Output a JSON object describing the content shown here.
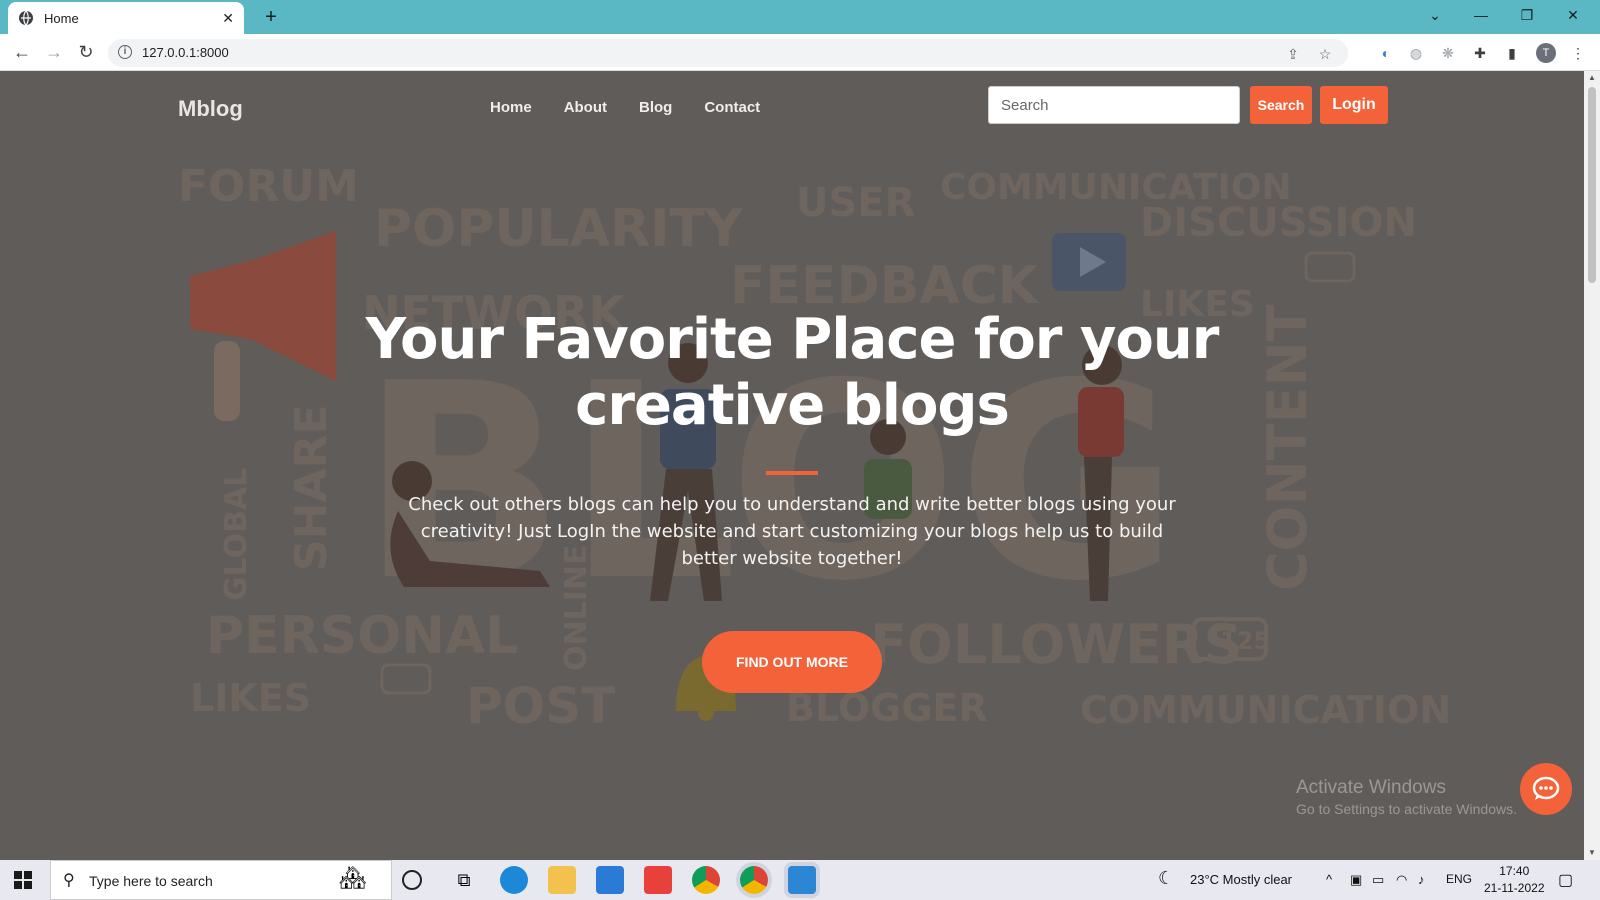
{
  "browser": {
    "tab_title": "Home",
    "url": "127.0.0.1:8000"
  },
  "site": {
    "brand": "Mblog",
    "nav": [
      "Home",
      "About",
      "Blog",
      "Contact"
    ],
    "search_placeholder": "Search",
    "search_button": "Search",
    "login_button": "Login"
  },
  "hero": {
    "title": "Your Favorite Place for your creative blogs",
    "text": "Check out others blogs can help you to understand and write better blogs using your creativity! Just LogIn the website and start customizing your blogs help us to build better website together!",
    "cta": "FIND OUT MORE"
  },
  "background_words": [
    "FORUM",
    "POPULARITY",
    "USER",
    "COMMUNICATION",
    "DISCUSSION",
    "FEEDBACK",
    "LIKES",
    "NETWORK",
    "BLOG",
    "CONTENT",
    "PERSONAL",
    "SHARE",
    "GLOBAL",
    "ONLINE",
    "FOLLOWERS",
    "POST",
    "BLOGGER",
    "COMMUNICATION",
    "LIKES",
    "125"
  ],
  "watermark": {
    "title": "Activate Windows",
    "sub": "Go to Settings to activate Windows."
  },
  "taskbar": {
    "search_placeholder": "Type here to search",
    "weather": "23°C  Mostly clear",
    "language": "ENG",
    "time": "17:40",
    "date": "21-11-2022"
  },
  "colors": {
    "accent": "#f4623a",
    "overlay": "#5f5c5a",
    "tab_bar": "#5ab8c4"
  }
}
